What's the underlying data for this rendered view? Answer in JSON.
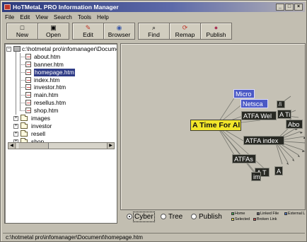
{
  "window": {
    "title": "HoTMetaL PRO Information Manager",
    "controls": [
      "_",
      "□",
      "×"
    ]
  },
  "menu": [
    "File",
    "Edit",
    "View",
    "Search",
    "Tools",
    "Help"
  ],
  "toolbar": [
    {
      "label": "New",
      "icon": "□"
    },
    {
      "label": "Open",
      "icon": "▣"
    },
    {
      "label": "Edit",
      "icon": "✎"
    },
    {
      "label": "Browser",
      "icon": "◉"
    },
    {
      "label": "Find",
      "icon": "⌕"
    },
    {
      "label": "Remap",
      "icon": "⟳"
    },
    {
      "label": "Publish",
      "icon": "●"
    }
  ],
  "tree": {
    "root": "c:\\hotmetal pro\\infomanager\\Docume",
    "files": [
      "about.htm",
      "banner.htm",
      "homepage.htm",
      "index.htm",
      "investor.htm",
      "main.htm",
      "resellus.htm",
      "shop.htm"
    ],
    "folders": [
      "images",
      "investor",
      "resell",
      "shop"
    ],
    "selected": "homepage.htm",
    "scroll_left": "◀",
    "scroll_right": "▶"
  },
  "graph": {
    "center": "A Time For All",
    "nodes": [
      {
        "label": "Micro",
        "tone": "blue"
      },
      {
        "label": "Netsca",
        "tone": "blue"
      },
      {
        "label": "ATFA Wel",
        "tone": "dark"
      },
      {
        "label": "A Ti",
        "tone": "dark"
      },
      {
        "label": "/i",
        "tone": "dark"
      },
      {
        "label": "Abo",
        "tone": "dark"
      },
      {
        "label": "ATFA index",
        "tone": "dark"
      },
      {
        "label": "ATFAs",
        "tone": "dark"
      },
      {
        "label": "A T",
        "tone": "dark"
      },
      {
        "label": "A",
        "tone": "dark"
      },
      {
        "label": "im",
        "tone": "dark"
      }
    ],
    "colors": {
      "center": "#f2e62a",
      "blue_node": "#4b59c5",
      "dark_node": "#282923"
    }
  },
  "views": [
    {
      "label": "Cyber",
      "selected": true
    },
    {
      "label": "Tree",
      "selected": false
    },
    {
      "label": "Publish",
      "selected": false
    }
  ],
  "legend": [
    {
      "label": "Home",
      "color": "#48a853"
    },
    {
      "label": "Linked File",
      "color": "#60606a"
    },
    {
      "label": "External L",
      "color": "#4e78c5"
    },
    {
      "label": "Selected",
      "color": "#efe04d"
    },
    {
      "label": "Broken Link",
      "color": "#c94b4b"
    }
  ],
  "status": {
    "path": "c:\\hotmetal pro\\infomanager\\Document\\homepage.htm"
  }
}
